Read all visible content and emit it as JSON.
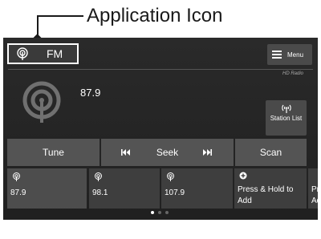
{
  "callout": {
    "label": "Application Icon"
  },
  "topbar": {
    "app_icon": {
      "label": "FM",
      "icon": "radio-antenna-icon"
    },
    "menu": {
      "label": "Menu",
      "icon": "hamburger-menu-icon"
    },
    "logo_text": "HD Radio"
  },
  "now_playing": {
    "frequency": "87.9",
    "icon": "radio-broadcast-icon"
  },
  "station_list": {
    "label": "Station List",
    "icon": "broadcast-tower-icon"
  },
  "controls": {
    "tune": "Tune",
    "seek": "Seek",
    "scan": "Scan"
  },
  "presets": [
    {
      "frequency": "87.9",
      "selected": true
    },
    {
      "frequency": "98.1"
    },
    {
      "frequency": "107.9"
    }
  ],
  "add_preset": {
    "label": "Press & Hold to Add"
  },
  "partial_preset": {
    "label": "Press & Hold to Add"
  },
  "pagination": {
    "total": 3,
    "active": 1
  },
  "colors": {
    "screen_bg": "#252525",
    "button_bg": "#545454",
    "text": "#ffffff"
  }
}
